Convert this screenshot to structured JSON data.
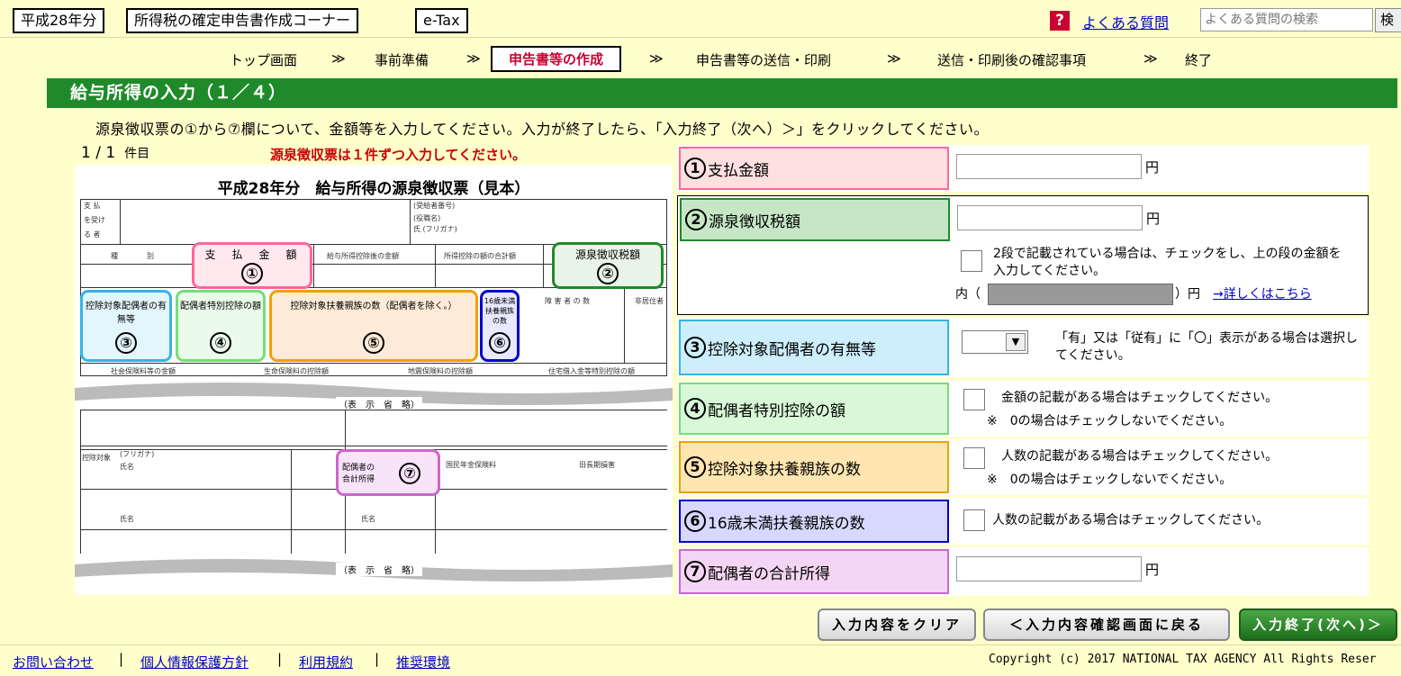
{
  "header": {
    "year": "平成28年分",
    "corner": "所得税の確定申告書作成コーナー",
    "etax": "e-Tax",
    "faq_icon": "?",
    "faq_link": "よくある質問",
    "faq_search_placeholder": "よくある質問の検索",
    "faq_search_button": "検"
  },
  "steps": {
    "items": [
      "トップ画面",
      "事前準備",
      "申告書等の作成",
      "申告書等の送信・印刷",
      "送信・印刷後の確認事項",
      "終了"
    ],
    "active_index": 2,
    "separator": "≫"
  },
  "page": {
    "title": "給与所得の入力（１／４）",
    "instruction": "源泉徴収票の①から⑦欄について、金額等を入力してください。入力が終了したら、「入力終了（次へ）＞」をクリックしてください。",
    "counter": "1 / 1",
    "counter_unit": "件目",
    "note": "源泉徴収票は１件ずつ入力してください。"
  },
  "slip": {
    "title": "平成28年分　給与所得の源泉徴収票（見本）",
    "payment_amount": "支　払　金　額",
    "withholding": "源泉徴収税額",
    "spouse_label": "控除対象配偶者の有無等",
    "spouse_special": "配偶者特別控除の額",
    "dependents": "控除対象扶養親族の数（配偶者を除く。）",
    "under16": "16歳未満扶養親族の数",
    "spouse_income": "配偶者の合計所得",
    "omitted": "（表　示　省　略）",
    "circled": [
      "①",
      "②",
      "③",
      "④",
      "⑤",
      "⑥",
      "⑦"
    ]
  },
  "form": {
    "rows": [
      {
        "num": "1",
        "label": "支払金額",
        "unit": "円"
      },
      {
        "num": "2",
        "label": "源泉徴収税額",
        "unit": "円",
        "check_note": "2段で記載されている場合は、チェックをし、上の段の金額を入力してください。",
        "inner_label": "内（",
        "inner_unit": "）円",
        "detail_link": "→詳しくはこちら"
      },
      {
        "num": "3",
        "label": "控除対象配偶者の有無等",
        "note": "「有」又は「従有」に「〇」表示がある場合は選択してください。"
      },
      {
        "num": "4",
        "label": "配偶者特別控除の額",
        "note": "金額の記載がある場合はチェックしてください。",
        "sub": "※　0の場合はチェックしないでください。"
      },
      {
        "num": "5",
        "label": "控除対象扶養親族の数",
        "note": "人数の記載がある場合はチェックしてください。",
        "sub": "※　0の場合はチェックしないでください。"
      },
      {
        "num": "6",
        "label": "16歳未満扶養親族の数",
        "note": "人数の記載がある場合はチェックしてください。"
      },
      {
        "num": "7",
        "label": "配偶者の合計所得",
        "unit": "円"
      }
    ]
  },
  "buttons": {
    "clear": "入力内容をクリア",
    "back": "＜入力内容確認画面に戻る",
    "next": "入力終了(次へ)＞"
  },
  "footer": {
    "links": [
      "お問い合わせ",
      "個人情報保護方針",
      "利用規約",
      "推奨環境"
    ],
    "separator": "|",
    "copyright": "Copyright (c) 2017 NATIONAL TAX AGENCY All Rights Reser"
  },
  "colors": {
    "title_bg": "#1f8a2a",
    "row1": "#ffe0e0",
    "row1_border": "#ff6699",
    "row2": "#c6e7c6",
    "row2_border": "#1f8a2a",
    "row3": "#cdeefb",
    "row3_border": "#33b5e5",
    "row4": "#d8f8d8",
    "row4_border": "#77dd77",
    "row5": "#ffe6b0",
    "row5_border": "#f0a000",
    "row6": "#d8d8ff",
    "row6_border": "#0000cc",
    "row7": "#f4d6f4",
    "row7_border": "#cc66cc"
  }
}
